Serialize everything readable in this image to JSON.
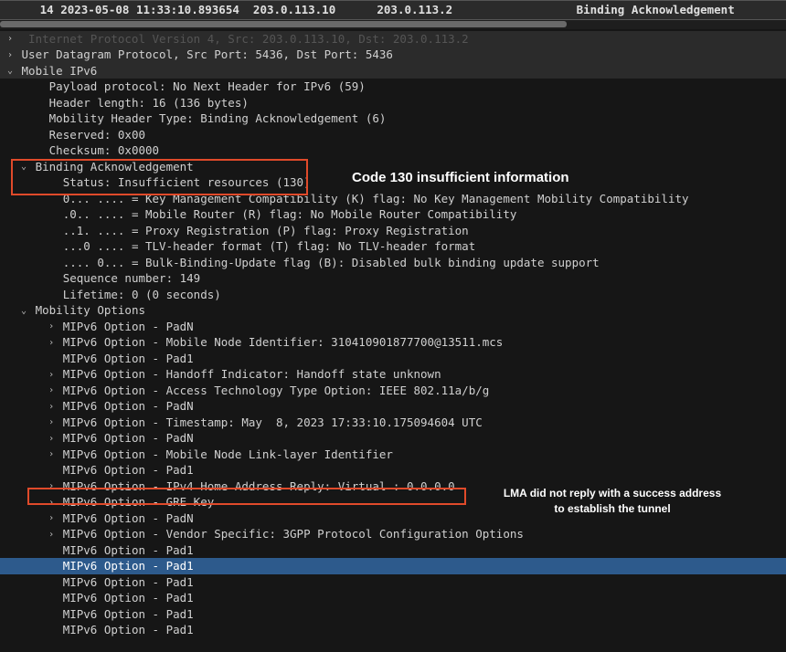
{
  "header": {
    "text": "     14 2023-05-08 11:33:10.893654  203.0.113.10      203.0.113.2                  Binding Acknowledgement"
  },
  "annotations": {
    "box1_label": "Code 130  insufficient information",
    "box2_line1": "LMA did not reply with a success address",
    "box2_line2": "to establish the tunnel"
  },
  "truncated_top": "  Internet Protocol Version 4, Src: 203.0.113.10, Dst: 203.0.113.2",
  "lines": [
    {
      "arrow": ">",
      "indent": 0,
      "proto": true,
      "text": "User Datagram Protocol, Src Port: 5436, Dst Port: 5436"
    },
    {
      "arrow": "v",
      "indent": 0,
      "proto": true,
      "text": "Mobile IPv6"
    },
    {
      "arrow": "",
      "indent": 2,
      "text": "Payload protocol: No Next Header for IPv6 (59)"
    },
    {
      "arrow": "",
      "indent": 2,
      "text": "Header length: 16 (136 bytes)"
    },
    {
      "arrow": "",
      "indent": 2,
      "text": "Mobility Header Type: Binding Acknowledgement (6)"
    },
    {
      "arrow": "",
      "indent": 2,
      "text": "Reserved: 0x00"
    },
    {
      "arrow": "",
      "indent": 2,
      "text": "Checksum: 0x0000"
    },
    {
      "arrow": "v",
      "indent": 1,
      "text": "Binding Acknowledgement"
    },
    {
      "arrow": "",
      "indent": 3,
      "text": "Status: Insufficient resources (130)"
    },
    {
      "arrow": "",
      "indent": 3,
      "text": "0... .... = Key Management Compatibility (K) flag: No Key Management Mobility Compatibility"
    },
    {
      "arrow": "",
      "indent": 3,
      "text": ".0.. .... = Mobile Router (R) flag: No Mobile Router Compatibility"
    },
    {
      "arrow": "",
      "indent": 3,
      "text": "..1. .... = Proxy Registration (P) flag: Proxy Registration"
    },
    {
      "arrow": "",
      "indent": 3,
      "text": "...0 .... = TLV-header format (T) flag: No TLV-header format"
    },
    {
      "arrow": "",
      "indent": 3,
      "text": ".... 0... = Bulk-Binding-Update flag (B): Disabled bulk binding update support"
    },
    {
      "arrow": "",
      "indent": 3,
      "text": "Sequence number: 149"
    },
    {
      "arrow": "",
      "indent": 3,
      "text": "Lifetime: 0 (0 seconds)"
    },
    {
      "arrow": "v",
      "indent": 1,
      "text": "Mobility Options"
    },
    {
      "arrow": ">",
      "indent": 3,
      "text": "MIPv6 Option - PadN"
    },
    {
      "arrow": ">",
      "indent": 3,
      "text": "MIPv6 Option - Mobile Node Identifier: 310410901877700@13511.mcs"
    },
    {
      "arrow": "",
      "indent": 3,
      "text": "MIPv6 Option - Pad1"
    },
    {
      "arrow": ">",
      "indent": 3,
      "text": "MIPv6 Option - Handoff Indicator: Handoff state unknown"
    },
    {
      "arrow": ">",
      "indent": 3,
      "text": "MIPv6 Option - Access Technology Type Option: IEEE 802.11a/b/g"
    },
    {
      "arrow": ">",
      "indent": 3,
      "text": "MIPv6 Option - PadN"
    },
    {
      "arrow": ">",
      "indent": 3,
      "text": "MIPv6 Option - Timestamp: May  8, 2023 17:33:10.175094604 UTC"
    },
    {
      "arrow": ">",
      "indent": 3,
      "text": "MIPv6 Option - PadN"
    },
    {
      "arrow": ">",
      "indent": 3,
      "text": "MIPv6 Option - Mobile Node Link-layer Identifier"
    },
    {
      "arrow": "",
      "indent": 3,
      "text": "MIPv6 Option - Pad1"
    },
    {
      "arrow": ">",
      "indent": 3,
      "text": "MIPv6 Option - IPv4 Home Address Reply: Virtual : 0.0.0.0"
    },
    {
      "arrow": ">",
      "indent": 3,
      "text": "MIPv6 Option - GRE Key"
    },
    {
      "arrow": ">",
      "indent": 3,
      "text": "MIPv6 Option - PadN"
    },
    {
      "arrow": ">",
      "indent": 3,
      "text": "MIPv6 Option - Vendor Specific: 3GPP Protocol Configuration Options"
    },
    {
      "arrow": "",
      "indent": 3,
      "text": "MIPv6 Option - Pad1"
    },
    {
      "arrow": "",
      "indent": 3,
      "text": "MIPv6 Option - Pad1",
      "selected": true
    },
    {
      "arrow": "",
      "indent": 3,
      "text": "MIPv6 Option - Pad1"
    },
    {
      "arrow": "",
      "indent": 3,
      "text": "MIPv6 Option - Pad1"
    },
    {
      "arrow": "",
      "indent": 3,
      "text": "MIPv6 Option - Pad1"
    },
    {
      "arrow": "",
      "indent": 3,
      "text": "MIPv6 Option - Pad1"
    }
  ]
}
